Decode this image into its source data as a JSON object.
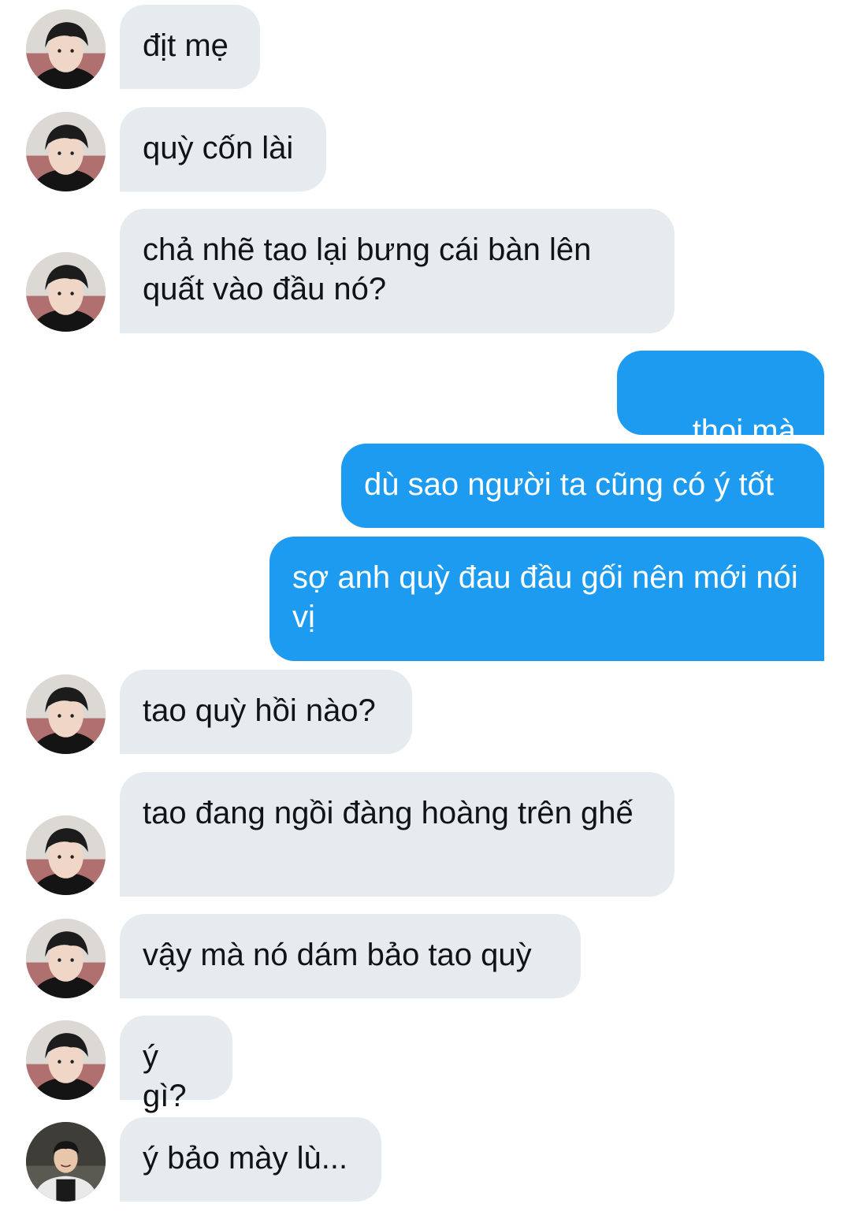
{
  "messages": [
    {
      "sender": "them",
      "text": "địt mẹ"
    },
    {
      "sender": "them",
      "text": "quỳ cốn lài"
    },
    {
      "sender": "them",
      "text": "chả nhẽ tao lại bưng cái bàn lên quất vào đầu nó?"
    },
    {
      "sender": "me",
      "text": "thoi mà",
      "emoji": "pensive-face-emoji"
    },
    {
      "sender": "me",
      "text": "dù sao người ta cũng có ý tốt"
    },
    {
      "sender": "me",
      "text": "sợ anh quỳ đau đầu gối nên mới nói vị"
    },
    {
      "sender": "them",
      "text": "tao quỳ hồi nào?"
    },
    {
      "sender": "them",
      "text": "tao đang ngồi đàng hoàng trên ghế"
    },
    {
      "sender": "them",
      "text": "vậy mà nó dám bảo tao quỳ"
    },
    {
      "sender": "them",
      "text": "ý gì?"
    },
    {
      "sender": "them2",
      "text": "ý bảo mày lù..."
    }
  ],
  "colors": {
    "incoming_bubble": "#e6ebf0",
    "outgoing_bubble": "#1d9bf0",
    "incoming_text": "#0f1419",
    "outgoing_text": "#ffffff"
  },
  "icons": {
    "avatar_them": "user-avatar-dark-hair",
    "avatar_them2": "user-avatar-smiling",
    "emoji": "pensive-face-emoji"
  }
}
